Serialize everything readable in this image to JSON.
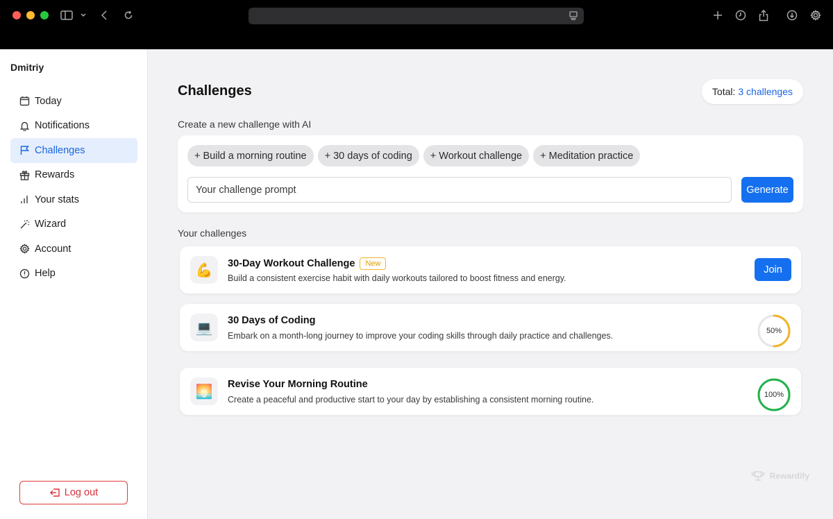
{
  "browser": {
    "icons": [
      "sidebar-toggle-icon",
      "chevron-down-icon",
      "back-icon",
      "reload-icon",
      "reader-icon",
      "plus-icon",
      "history-icon",
      "share-icon",
      "download-icon",
      "gear-icon"
    ]
  },
  "sidebar": {
    "username": "Dmitriy",
    "items": [
      {
        "label": "Today",
        "icon": "calendar-icon",
        "active": false
      },
      {
        "label": "Notifications",
        "icon": "bell-icon",
        "active": false
      },
      {
        "label": "Challenges",
        "icon": "flag-icon",
        "active": true
      },
      {
        "label": "Rewards",
        "icon": "gift-icon",
        "active": false
      },
      {
        "label": "Your stats",
        "icon": "bar-chart-icon",
        "active": false
      },
      {
        "label": "Wizard",
        "icon": "magic-wand-icon",
        "active": false
      },
      {
        "label": "Account",
        "icon": "gear-icon",
        "active": false
      },
      {
        "label": "Help",
        "icon": "alert-circle-icon",
        "active": false
      }
    ],
    "logout_label": "Log out"
  },
  "main": {
    "title": "Challenges",
    "total_label": "Total:",
    "total_value": "3 challenges",
    "create_label": "Create a new challenge with AI",
    "chips": [
      "+ Build a morning routine",
      "+ 30 days of coding",
      "+ Workout challenge",
      "+ Meditation practice"
    ],
    "prompt_placeholder": "Your challenge prompt",
    "prompt_value": "",
    "generate_label": "Generate",
    "your_label": "Your challenges",
    "challenges": [
      {
        "emoji": "💪",
        "title": "30-Day Workout Challenge",
        "badge": "New",
        "description": "Build a consistent exercise habit with daily workouts tailored to boost fitness and energy.",
        "action_label": "Join"
      },
      {
        "emoji": "💻",
        "title": "30 Days of Coding",
        "description": "Embark on a month-long journey to improve your coding skills through daily practice and challenges.",
        "progress": 50,
        "progress_label": "50%",
        "progress_color": "#f0b429"
      },
      {
        "emoji": "🌅",
        "title": "Revise Your Morning Routine",
        "description": "Create a peaceful and productive start to your day by establishing a consistent morning routine.",
        "progress": 100,
        "progress_label": "100%",
        "progress_color": "#22b24c"
      }
    ],
    "brand": "Rewardify"
  },
  "colors": {
    "accent": "#1570ef",
    "danger": "#d8303a",
    "badge": "#f0b429"
  }
}
